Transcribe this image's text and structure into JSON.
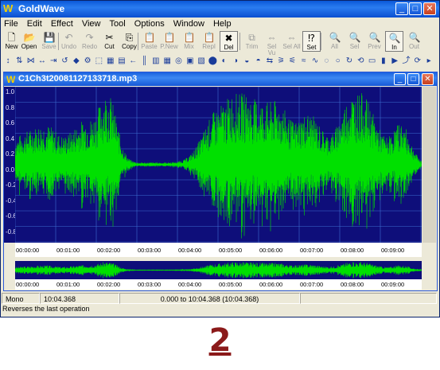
{
  "window": {
    "title": "GoldWave",
    "app_icon": "W",
    "minimize": "_",
    "maximize": "□",
    "close": "✕"
  },
  "menu": [
    "File",
    "Edit",
    "Effect",
    "View",
    "Tool",
    "Options",
    "Window",
    "Help"
  ],
  "toolbar1": [
    {
      "label": "New",
      "icon": "new-icon",
      "glyph": "🗋",
      "enabled": true
    },
    {
      "label": "Open",
      "icon": "open-icon",
      "glyph": "📂",
      "enabled": true
    },
    {
      "label": "Save",
      "icon": "save-icon",
      "glyph": "💾",
      "enabled": false
    },
    {
      "label": "Undo",
      "icon": "undo-icon",
      "glyph": "↶",
      "enabled": false
    },
    {
      "label": "Redo",
      "icon": "redo-icon",
      "glyph": "↷",
      "enabled": false
    },
    {
      "label": "Cut",
      "icon": "cut-icon",
      "glyph": "✂",
      "enabled": true
    },
    {
      "label": "Copy",
      "icon": "copy-icon",
      "glyph": "⎘",
      "enabled": true
    },
    {
      "label": "Paste",
      "icon": "paste-icon",
      "glyph": "📋",
      "enabled": false
    },
    {
      "label": "P.New",
      "icon": "paste-new-icon",
      "glyph": "📋",
      "enabled": false
    },
    {
      "label": "Mix",
      "icon": "mix-icon",
      "glyph": "📋",
      "enabled": false
    },
    {
      "label": "Repl",
      "icon": "replace-icon",
      "glyph": "📋",
      "enabled": false
    },
    {
      "label": "Del",
      "icon": "delete-icon",
      "glyph": "✖",
      "enabled": true,
      "pressed": true
    },
    {
      "label": "Trim",
      "icon": "trim-icon",
      "glyph": "⧉",
      "enabled": false
    },
    {
      "label": "Sel Vu",
      "icon": "select-view-icon",
      "glyph": "⇔",
      "enabled": false
    },
    {
      "label": "Sel All",
      "icon": "select-all-icon",
      "glyph": "⇔",
      "enabled": false
    },
    {
      "label": "Set",
      "icon": "set-icon",
      "glyph": "⁉",
      "enabled": true,
      "pressed": true
    },
    {
      "label": "All",
      "icon": "zoom-all-icon",
      "glyph": "🔍",
      "enabled": false
    },
    {
      "label": "Sel",
      "icon": "zoom-select-icon",
      "glyph": "🔍",
      "enabled": false
    },
    {
      "label": "Prev",
      "icon": "zoom-prev-icon",
      "glyph": "🔍",
      "enabled": false
    },
    {
      "label": "In",
      "icon": "zoom-in-icon",
      "glyph": "🔍",
      "enabled": true,
      "pressed": true
    },
    {
      "label": "Out",
      "icon": "zoom-out-icon",
      "glyph": "🔍",
      "enabled": false
    }
  ],
  "document": {
    "title": "C1Ch3t20081127133718.mp3",
    "icon": "W"
  },
  "y_axis_labels": [
    "1.0",
    "0.8",
    "0.6",
    "0.4",
    "0.2",
    "0.0",
    "-0.2",
    "-0.4",
    "-0.6",
    "-0.8"
  ],
  "time_labels": [
    "00:00:00",
    "00:01:00",
    "00:02:00",
    "00:03:00",
    "00:04:00",
    "00:05:00",
    "00:06:00",
    "00:07:00",
    "00:08:00",
    "00:09:00"
  ],
  "status": {
    "channel": "Mono",
    "duration": "10:04.368",
    "selection": "0.000 to 10:04.368 (10:04.368)",
    "hint": "Reverses the last operation"
  },
  "caption": "2",
  "colors": {
    "wave_bg": "#0e0e7a",
    "wave": "#00e000",
    "grid": "#3d6fd0",
    "accent": "#0a58d8",
    "caption": "#8b1a1a"
  }
}
